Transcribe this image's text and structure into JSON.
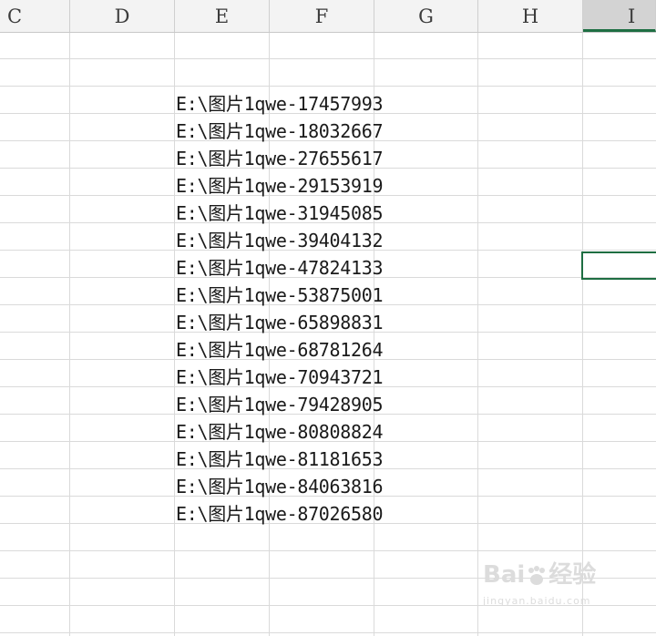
{
  "columns": [
    {
      "label": "C",
      "selected": false
    },
    {
      "label": "D",
      "selected": false
    },
    {
      "label": "E",
      "selected": false
    },
    {
      "label": "F",
      "selected": false
    },
    {
      "label": "G",
      "selected": false
    },
    {
      "label": "H",
      "selected": false
    },
    {
      "label": "I",
      "selected": true
    }
  ],
  "cells": [
    "E:\\图片1qwe-17457993",
    "E:\\图片1qwe-18032667",
    "E:\\图片1qwe-27655617",
    "E:\\图片1qwe-29153919",
    "E:\\图片1qwe-31945085",
    "E:\\图片1qwe-39404132",
    "E:\\图片1qwe-47824133",
    "E:\\图片1qwe-53875001",
    "E:\\图片1qwe-65898831",
    "E:\\图片1qwe-68781264",
    "E:\\图片1qwe-70943721",
    "E:\\图片1qwe-79428905",
    "E:\\图片1qwe-80808824",
    "E:\\图片1qwe-81181653",
    "E:\\图片1qwe-84063816",
    "E:\\图片1qwe-87026580"
  ],
  "watermark": {
    "brand": "Bai",
    "suffix": "经验",
    "sub": "jingyan.baidu.com"
  },
  "colors": {
    "selection": "#1e6e42",
    "header_bg": "#f3f3f3",
    "gridline": "#dadada"
  }
}
